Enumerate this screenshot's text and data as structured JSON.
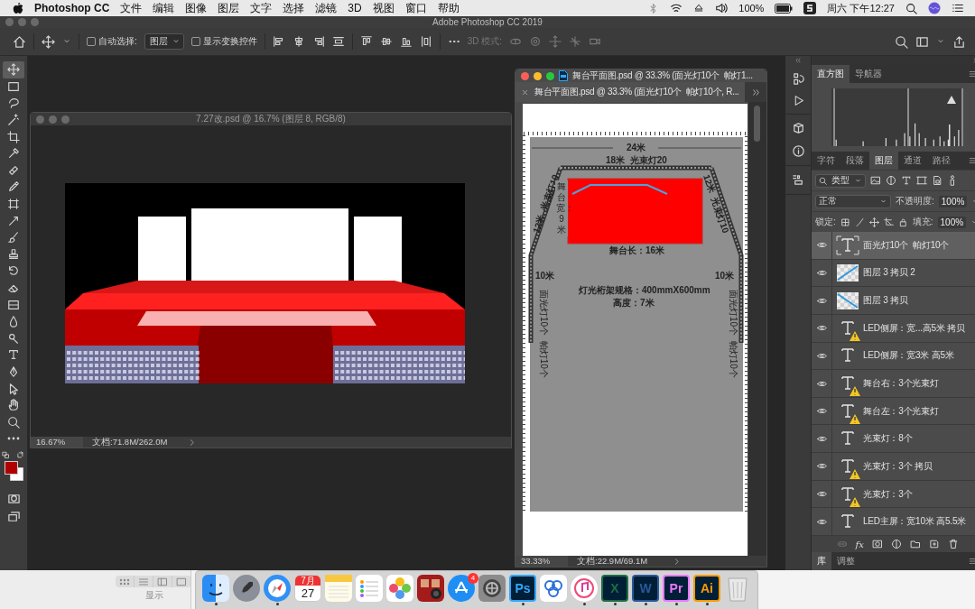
{
  "menu_bar": {
    "app_name": "Photoshop CC",
    "menus": [
      "文件",
      "编辑",
      "图像",
      "图层",
      "文字",
      "选择",
      "滤镜",
      "3D",
      "视图",
      "窗口",
      "帮助"
    ],
    "battery": "100%",
    "clock": "周六 下午12:27"
  },
  "app_title": "Adobe Photoshop CC 2019",
  "options_bar": {
    "auto_select": {
      "label": "自动选择:",
      "checked": false
    },
    "auto_select_target": "图层",
    "transform_controls": {
      "label": "显示变换控件",
      "checked": false
    },
    "mode_3d": "3D 模式:"
  },
  "tools": [
    {
      "kind": "move",
      "selected": true
    },
    {
      "kind": "marquee",
      "selected": false
    },
    {
      "kind": "lasso",
      "selected": false
    },
    {
      "kind": "magic-wand",
      "selected": false
    },
    {
      "kind": "crop",
      "selected": false
    },
    {
      "kind": "eyedropper",
      "selected": false
    },
    {
      "kind": "healing",
      "selected": false
    },
    {
      "kind": "pencil",
      "selected": false
    },
    {
      "kind": "frame",
      "selected": false
    },
    {
      "kind": "slice",
      "selected": false
    },
    {
      "kind": "brush",
      "selected": false
    },
    {
      "kind": "stamp",
      "selected": false
    },
    {
      "kind": "history-brush",
      "selected": false
    },
    {
      "kind": "eraser",
      "selected": false
    },
    {
      "kind": "gradient",
      "selected": false
    },
    {
      "kind": "blur",
      "selected": false
    },
    {
      "kind": "dodge",
      "selected": false
    },
    {
      "kind": "type",
      "selected": false
    },
    {
      "kind": "pen",
      "selected": false
    },
    {
      "kind": "path-select",
      "selected": false
    },
    {
      "kind": "hand",
      "selected": false
    },
    {
      "kind": "zoom",
      "selected": false
    },
    {
      "kind": "more",
      "selected": false
    }
  ],
  "documents": [
    {
      "kind": "render",
      "active": false,
      "title": "7.27改.psd @ 16.7% (图层 8, RGB/8)",
      "zoom": "16.67%",
      "doc_size": "文档:71.8M/262.0M"
    },
    {
      "kind": "floor-plan",
      "active": true,
      "title": "舞台平面图.psd @ 33.3% (面光灯10个  帕灯1...",
      "tab": "舞台平面图.psd @ 33.3% (面光灯10个  帕灯10个, R...",
      "zoom": "33.33%",
      "doc_size": "文档:22.9M/69.1M",
      "labels": {
        "width_top": "24米",
        "truss_top": "18米  光束灯20",
        "truss_left": "12米  光束灯10",
        "truss_right": "12米  光束灯10",
        "stage_width": "舞台宽：9米",
        "stage_length": "舞台长：16米",
        "side_left": "10米",
        "side_right": "10米",
        "side_lights_left": "面光灯10个  帕灯10个",
        "side_lights_right": "面光灯10个  帕灯10个",
        "spec": "灯光桁架规格：400mmX600mm",
        "height": "高度：7米"
      }
    }
  ],
  "histogram_tabs": [
    {
      "label": "直方图",
      "selected": true
    },
    {
      "label": "导航器",
      "selected": false
    }
  ],
  "layer_tabs": [
    {
      "label": "字符",
      "selected": false
    },
    {
      "label": "段落",
      "selected": false
    },
    {
      "label": "图层",
      "selected": true
    },
    {
      "label": "通道",
      "selected": false
    },
    {
      "label": "路径",
      "selected": false
    }
  ],
  "layer_filter": "类型",
  "blend_mode": "正常",
  "opacity_label": "不透明度:",
  "opacity": "100%",
  "lock_label": "锁定:",
  "fill_label": "填充:",
  "fill": "100%",
  "layers": [
    {
      "name": "面光灯10个  帕灯10个",
      "kind": "text",
      "warning": false,
      "visible": true,
      "selected": true
    },
    {
      "name": "图层 3 拷贝 2",
      "kind": "image",
      "warning": false,
      "visible": true,
      "selected": false
    },
    {
      "name": "图层 3 拷贝",
      "kind": "image",
      "warning": false,
      "visible": true,
      "selected": false
    },
    {
      "name": "LED侧屏：宽...高5米 拷贝",
      "kind": "text",
      "warning": true,
      "visible": true,
      "selected": false
    },
    {
      "name": "LED侧屏：宽3米 高5米",
      "kind": "text",
      "warning": false,
      "visible": true,
      "selected": false
    },
    {
      "name": "舞台右：3个光束灯",
      "kind": "text",
      "warning": true,
      "visible": true,
      "selected": false
    },
    {
      "name": "舞台左：3个光束灯",
      "kind": "text",
      "warning": true,
      "visible": true,
      "selected": false
    },
    {
      "name": "光束灯：8个",
      "kind": "text",
      "warning": false,
      "visible": true,
      "selected": false
    },
    {
      "name": "光束灯：3个 拷贝",
      "kind": "text",
      "warning": true,
      "visible": true,
      "selected": false
    },
    {
      "name": "光束灯：3个",
      "kind": "text",
      "warning": true,
      "visible": true,
      "selected": false
    },
    {
      "name": "LED主屏：宽10米 高5.5米",
      "kind": "text",
      "warning": false,
      "visible": true,
      "selected": false
    }
  ],
  "effects_label": "fx",
  "bottom_tabs": [
    {
      "label": "库",
      "selected": true
    },
    {
      "label": "调整",
      "selected": false
    }
  ],
  "finder_strip": {
    "label": "显示"
  },
  "dock": [
    {
      "kind": "finder",
      "running": true
    },
    {
      "kind": "launchpad",
      "running": false
    },
    {
      "kind": "safari",
      "running": true
    },
    {
      "kind": "calendar",
      "month": "7月",
      "day": "27",
      "running": false
    },
    {
      "kind": "notes",
      "running": false
    },
    {
      "kind": "reminders",
      "running": false
    },
    {
      "kind": "photos",
      "running": false
    },
    {
      "kind": "photo-booth",
      "running": false
    },
    {
      "kind": "app-store",
      "badge": "4",
      "running": false
    },
    {
      "kind": "settings",
      "running": false
    },
    {
      "kind": "adobe",
      "label": "Ps",
      "color": "#31a8ff",
      "running": true
    },
    {
      "kind": "cloud",
      "running": false
    },
    {
      "kind": "music",
      "running": true
    },
    {
      "kind": "adobe",
      "label": "X",
      "color": "#1d6f42",
      "running": true
    },
    {
      "kind": "adobe",
      "label": "W",
      "color": "#2b579a",
      "running": true
    },
    {
      "kind": "adobe",
      "label": "Pr",
      "color": "#ea77ff",
      "running": true
    },
    {
      "kind": "adobe",
      "label": "Ai",
      "color": "#ff9a00",
      "running": true
    },
    {
      "kind": "trash",
      "running": false
    }
  ]
}
